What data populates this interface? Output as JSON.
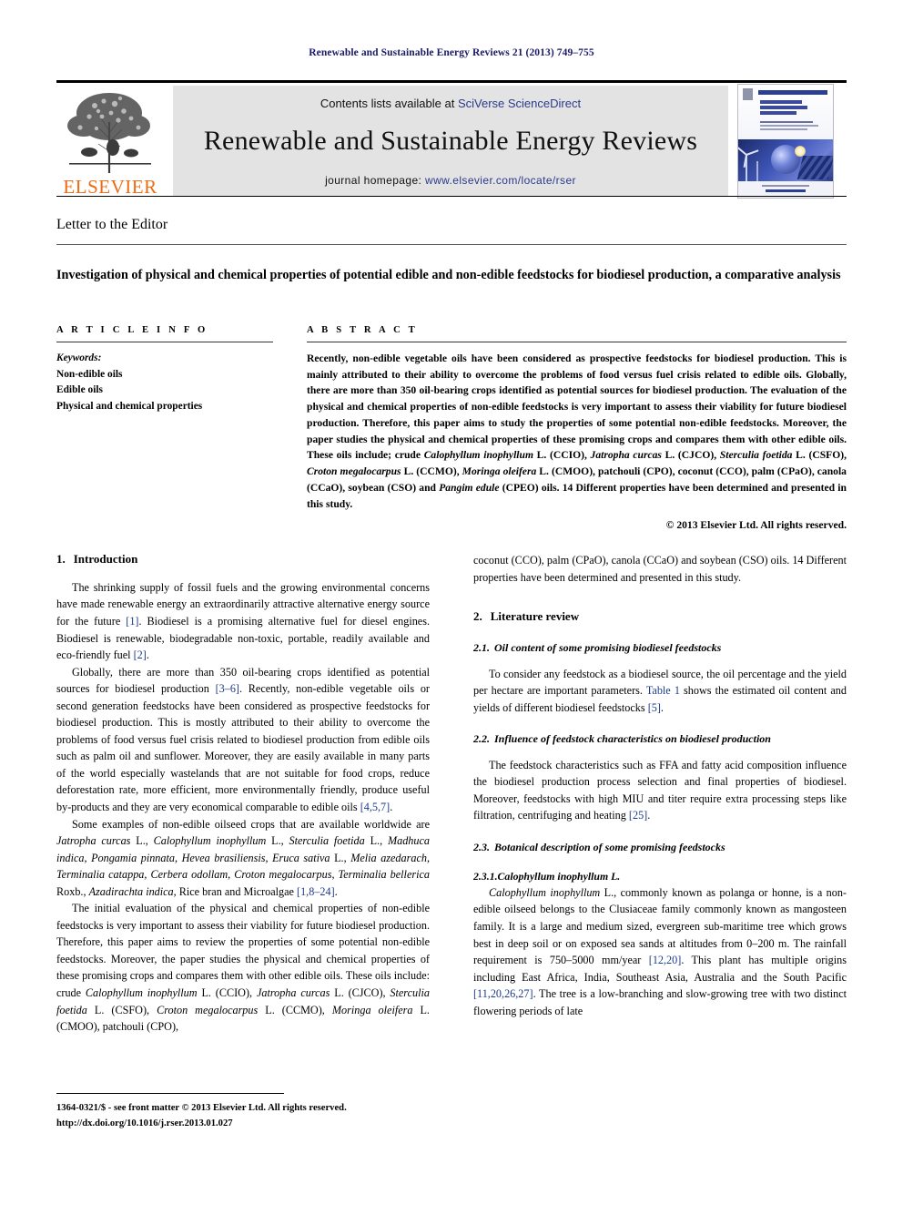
{
  "running_head": "Renewable and Sustainable Energy Reviews 21 (2013) 749–755",
  "masthead": {
    "contents_prefix": "Contents lists available at ",
    "sciencedirect_link": "SciVerse ScienceDirect",
    "journal_title": "Renewable and Sustainable Energy Reviews",
    "homepage_prefix": "journal homepage: ",
    "homepage_link": "www.elsevier.com/locate/rser",
    "publisher": "ELSEVIER",
    "cover_alt": "journal-cover-thumbnail"
  },
  "article": {
    "type_label": "Letter to the Editor",
    "title": "Investigation of physical and chemical properties of potential edible and non-edible feedstocks for biodiesel production, a comparative analysis"
  },
  "article_info": {
    "heading": "A R T I C L E   I N F O",
    "keywords_label": "Keywords:",
    "keywords": [
      "Non-edible oils",
      "Edible oils",
      "Physical and chemical properties"
    ]
  },
  "abstract": {
    "heading": "A B S T R A C T",
    "paragraph_1": "Recently, non-edible vegetable oils have been considered as prospective feedstocks for biodiesel production. This is mainly attributed to their ability to overcome the problems of food versus fuel crisis related to edible oils. Globally, there are more than 350 oil-bearing crops identified as potential sources for biodiesel production. The evaluation of the physical and chemical properties of non-edible feedstocks is very important to assess their viability for future biodiesel production. Therefore, this paper aims to study the properties of some potential non-edible feedstocks. Moreover, the paper studies the physical and chemical properties of these promising crops and compares them with other edible oils. These oils include; crude ",
    "sp1": "Calophyllum inophyllum",
    "mid1": " L. (CCIO), ",
    "sp2": "Jatropha curcas",
    "mid2": " L. (CJCO), ",
    "sp3": "Sterculia foetida",
    "mid3": " L. (CSFO), ",
    "sp4": "Croton megalocarpus",
    "mid4": " L. (CCMO), ",
    "sp5": "Moringa oleifera",
    "mid5": " L. (CMOO), patchouli (CPO), coconut (CCO), palm (CPaO), canola (CCaO), soybean (CSO) and ",
    "sp6": "Pangim edule",
    "mid6": " (CPEO) oils. 14 Different properties have been determined and presented in this study.",
    "copyright": "© 2013 Elsevier Ltd. All rights reserved."
  },
  "body": {
    "s1": {
      "number": "1.",
      "title": "Introduction",
      "p1_a": "The shrinking supply of fossil fuels and the growing environmental concerns have made renewable energy an extraordinarily attractive alternative energy source for the future ",
      "p1_r1": "[1]",
      "p1_b": ". Biodiesel is a promising alternative fuel for diesel engines. Biodiesel is renewable, biodegradable non-toxic, portable, readily available and eco-friendly fuel ",
      "p1_r2": "[2]",
      "p1_c": ".",
      "p2_a": "Globally, there are more than 350 oil-bearing crops identified as potential sources for biodiesel production ",
      "p2_r1": "[3–6]",
      "p2_b": ". Recently, non-edible vegetable oils or second generation feedstocks have been considered as prospective feedstocks for biodiesel production. This is mostly attributed to their ability to overcome the problems of food versus fuel crisis related to biodiesel production from edible oils such as palm oil and sunflower. Moreover, they are easily available in many parts of the world especially wastelands that are not suitable for food crops, reduce deforestation rate, more efficient, more environmentally friendly, produce useful by-products and they are very economical comparable to edible oils ",
      "p2_r2": "[4,5,7]",
      "p2_c": ".",
      "p3_a": "Some examples of non-edible oilseed crops that are available worldwide are ",
      "p3_i1": "Jatropha curcas",
      "p3_b": " L., ",
      "p3_i2": "Calophyllum inophyllum",
      "p3_c": " L., ",
      "p3_i3": "Sterculia foetida",
      "p3_d": " L., ",
      "p3_i4": "Madhuca indica, Pongamia pinnata, Hevea brasiliensis, Eruca sativa",
      "p3_e": " L., ",
      "p3_i5": "Melia azedarach, Terminalia catappa, Cerbera odollam, Croton megalocarpus, Terminalia bellerica",
      "p3_f": " Roxb., ",
      "p3_i6": "Azadirachta indica",
      "p3_g": ", Rice bran and Microalgae ",
      "p3_r1": "[1,8–24]",
      "p3_h": ".",
      "p4_a": "The initial evaluation of the physical and chemical properties of non-edible feedstocks is very important to assess their viability for future biodiesel production. Therefore, this paper aims to review the properties of some potential non-edible feedstocks. Moreover, the paper studies the physical and chemical properties of these promising crops and compares them with other edible oils. These oils include: crude ",
      "p4_i1": "Calophyllum inophyllum",
      "p4_b": " L. (CCIO), ",
      "p4_i2": "Jatropha curcas",
      "p4_c": " L. (CJCO), ",
      "p4_i3": "Sterculia foetida",
      "p4_d": " L. (CSFO), ",
      "p4_i4": "Croton megalocarpus",
      "p4_e": " L. (CCMO), ",
      "p4_i5": "Moringa oleifera",
      "p4_f": " L. (CMOO), patchouli (CPO),",
      "p4_cont": "coconut (CCO), palm (CPaO), canola (CCaO) and soybean (CSO) oils. 14 Different properties have been determined and presented in this study."
    },
    "s2": {
      "number": "2.",
      "title": "Literature review",
      "sub1_num": "2.1.",
      "sub1_title": "Oil content of some promising biodiesel feedstocks",
      "sub1_p_a": "To consider any feedstock as a biodiesel source, the oil percentage and the yield per hectare are important parameters. ",
      "sub1_p_tbl": "Table 1",
      "sub1_p_b": " shows the estimated oil content and yields of different biodiesel feedstocks ",
      "sub1_p_r": "[5]",
      "sub1_p_c": ".",
      "sub2_num": "2.2.",
      "sub2_title": "Influence of feedstock characteristics on biodiesel production",
      "sub2_p_a": "The feedstock characteristics such as FFA and fatty acid composition influence the biodiesel production process selection and final properties of biodiesel. Moreover, feedstocks with high MIU and titer require extra processing steps like filtration, centrifuging and heating ",
      "sub2_p_r": "[25]",
      "sub2_p_b": ".",
      "sub3_num": "2.3.",
      "sub3_title": "Botanical description of some promising feedstocks",
      "sub3_1_num": "2.3.1.",
      "sub3_1_title": "Calophyllum inophyllum L.",
      "sub3_1_i1": "Calophyllum inophyllum",
      "sub3_1_a": " L., commonly known as polanga or honne, is a non-edible oilseed belongs to the Clusiaceae family commonly known as mangosteen family. It is a large and medium sized, evergreen sub-maritime tree which grows best in deep soil or on exposed sea sands at altitudes from 0–200 m. The rainfall requirement is 750–5000 mm/year ",
      "sub3_1_r1": "[12,20]",
      "sub3_1_b": ". This plant has multiple origins including East Africa, India, Southeast Asia, Australia and the South Pacific ",
      "sub3_1_r2": "[11,20,26,27]",
      "sub3_1_c": ". The tree is a low-branching and slow-growing tree with two distinct flowering periods of late"
    }
  },
  "footer": {
    "line1": "1364-0321/$ - see front matter © 2013 Elsevier Ltd. All rights reserved.",
    "line2": "http://dx.doi.org/10.1016/j.rser.2013.01.027"
  },
  "colors": {
    "link_blue": "#2c3a8c",
    "ref_blue": "#1e3a8a",
    "elsevier_orange": "#eb6c14",
    "runhead_blue": "#1a1a66"
  }
}
